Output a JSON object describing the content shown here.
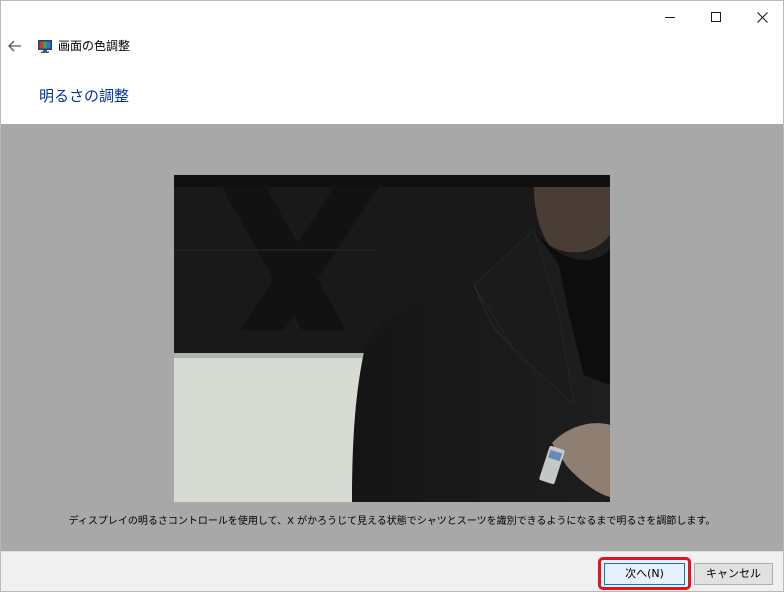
{
  "window": {
    "app_title": "画面の色調整",
    "page_heading": "明るさの調整"
  },
  "content": {
    "instruction": "ディスプレイの明るさコントロールを使用して、X がかろうじて見える状態でシャツとスーツを識別できるようになるまで明るさを調節します。"
  },
  "footer": {
    "next_label": "次へ(N)",
    "cancel_label": "キャンセル"
  },
  "colors": {
    "heading_blue": "#003399",
    "content_gray": "#a8a8a8",
    "highlight_red": "#e0141e",
    "footer_bg": "#f0f0f0"
  },
  "icons": {
    "back": "arrow-left-icon",
    "app": "display-color-icon",
    "minimize": "minimize-icon",
    "maximize": "maximize-icon",
    "close": "close-icon"
  }
}
